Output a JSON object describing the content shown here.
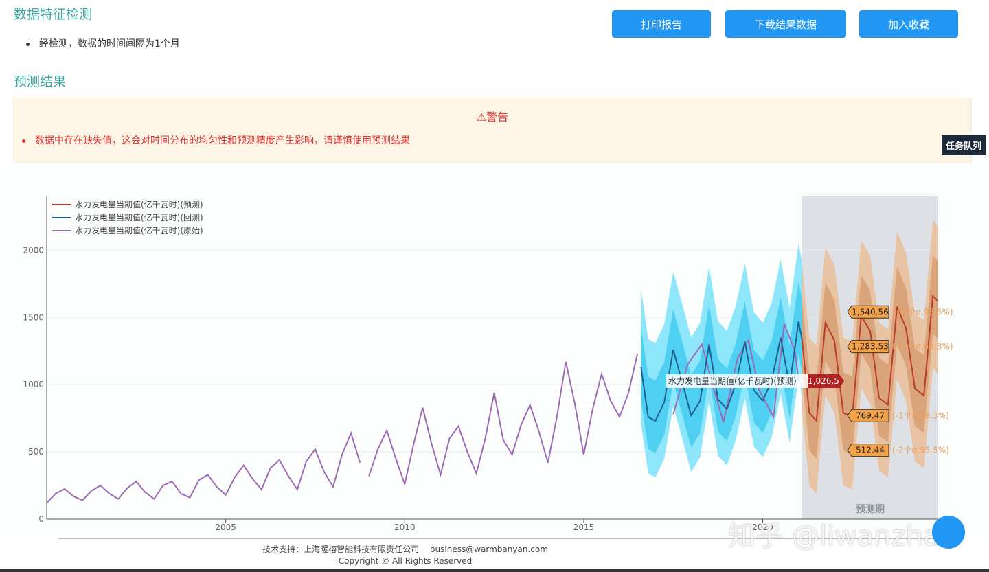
{
  "header": {
    "section1_title": "数据特征检测",
    "bullet": "经检测，数据的时间间隔为1个月",
    "section2_title": "预测结果"
  },
  "buttons": {
    "print": "打印报告",
    "download": "下载结果数据",
    "favorite": "加入收藏"
  },
  "warning": {
    "title": "⚠警告",
    "message": "数据中存在缺失值，这会对时间分布的均匀性和预测精度产生影响，请谨慎使用预测结果"
  },
  "side_tab": "任务队列",
  "footer": {
    "support": "技术支持：上海暖榕智能科技有限责任公司　 business@warmbanyan.com",
    "copyright": "Copyright ©  All Rights Reserved"
  },
  "watermark": "知乎 @liwanzhao",
  "colors": {
    "forecast": "#c0392b",
    "backtest": "#1f5f8b",
    "original": "#9b6bb5",
    "backtest_band_outer": "#8ee6fa",
    "backtest_band_inner": "#4fd0f3",
    "forecast_band_outer": "#e8c3a4",
    "forecast_band_inner": "#d9a47a",
    "forecast_period_bg": "#dde1e6"
  },
  "chart_data": {
    "type": "line",
    "title": "",
    "xlabel": "",
    "ylabel": "",
    "xlim": [
      2000.0,
      2024.9
    ],
    "ylim": [
      0,
      2400
    ],
    "x_ticks": [
      2005,
      2010,
      2015,
      2020
    ],
    "y_ticks": [
      0,
      500,
      1000,
      1500,
      2000
    ],
    "legend": [
      "水力发电量当期值(亿千瓦时)(预测)",
      "水力发电量当期值(亿千瓦时)(回测)",
      "水力发电量当期值(亿千瓦时)(原始)"
    ],
    "legend_position": "top-left",
    "forecast_region": {
      "start": 2021.1,
      "end": 2024.9,
      "label": "预测期"
    },
    "tooltip": {
      "series": "水力发电量当期值(亿千瓦时)(预测)",
      "value": "1,026.5"
    },
    "band_labels": [
      {
        "value": "1,540.56",
        "note": "(+2个σ,95.5%)"
      },
      {
        "value": "1,283.53",
        "note": "(+1个σ,68.3%)"
      },
      {
        "value": "769.47",
        "note": "(-1个σ,68.3%)"
      },
      {
        "value": "512.44",
        "note": "(-2个σ,95.5%)"
      }
    ],
    "series": [
      {
        "name": "水力发电量当期值(亿千瓦时)(原始)",
        "segments": [
          {
            "x": [
              2000.0,
              2000.25,
              2000.5,
              2000.75,
              2001.0,
              2001.25,
              2001.5,
              2001.75,
              2002.0,
              2002.25,
              2002.5,
              2002.75,
              2003.0,
              2003.25,
              2003.5,
              2003.75,
              2004.0,
              2004.25,
              2004.5,
              2004.75,
              2005.0,
              2005.25,
              2005.5,
              2005.75,
              2006.0,
              2006.25,
              2006.5,
              2006.75,
              2007.0,
              2007.25,
              2007.5,
              2007.75,
              2008.0,
              2008.25,
              2008.5,
              2008.75
            ],
            "y": [
              120,
              190,
              225,
              170,
              140,
              210,
              250,
              190,
              150,
              230,
              280,
              200,
              150,
              250,
              280,
              190,
              160,
              290,
              330,
              240,
              180,
              310,
              400,
              300,
              220,
              380,
              440,
              320,
              220,
              430,
              520,
              350,
              240,
              480,
              640,
              420
            ]
          },
          {
            "x": [
              2009.0,
              2009.25,
              2009.5,
              2009.75,
              2010.0,
              2010.25,
              2010.5,
              2010.75,
              2011.0,
              2011.25,
              2011.5,
              2011.75,
              2012.0,
              2012.25,
              2012.5,
              2012.75,
              2013.0,
              2013.25,
              2013.5,
              2013.75,
              2014.0,
              2014.25,
              2014.5,
              2014.75,
              2015.0,
              2015.25,
              2015.5,
              2015.75,
              2016.0,
              2016.25,
              2016.5
            ],
            "y": [
              320,
              520,
              660,
              450,
              260,
              560,
              830,
              560,
              330,
              600,
              690,
              500,
              340,
              600,
              940,
              590,
              480,
              700,
              850,
              650,
              420,
              760,
              1170,
              860,
              480,
              820,
              1080,
              880,
              760,
              940,
              1230
            ]
          },
          {
            "x": [
              2017.5,
              2017.9,
              2018.3,
              2018.6,
              2018.9,
              2019.3,
              2019.6,
              2019.9,
              2020.3,
              2020.6,
              2020.9,
              2021.0
            ],
            "y": [
              780,
              1150,
              1300,
              1000,
              720,
              1200,
              1330,
              960,
              760,
              1450,
              1250,
              1030
            ]
          }
        ]
      },
      {
        "name": "水力发电量当期值(亿千瓦时)(回测)",
        "x": [
          2016.6,
          2016.8,
          2017.0,
          2017.25,
          2017.5,
          2017.75,
          2018.0,
          2018.25,
          2018.5,
          2018.75,
          2019.0,
          2019.25,
          2019.5,
          2019.75,
          2020.0,
          2020.25,
          2020.5,
          2020.75,
          2021.0,
          2021.1
        ],
        "y": [
          1130,
          760,
          730,
          870,
          1260,
          1020,
          770,
          880,
          1300,
          890,
          820,
          1010,
          1320,
          960,
          880,
          1030,
          1350,
          990,
          1470,
          1330
        ]
      },
      {
        "name": "水力发电量当期值(亿千瓦时)(预测)",
        "x": [
          2021.1,
          2021.3,
          2021.5,
          2021.75,
          2022.0,
          2022.25,
          2022.5,
          2022.75,
          2023.0,
          2023.25,
          2023.5,
          2023.75,
          2024.0,
          2024.25,
          2024.5,
          2024.75,
          2024.9
        ],
        "y": [
          1330,
          790,
          730,
          1460,
          1330,
          790,
          760,
          1510,
          1400,
          900,
          850,
          1580,
          1420,
          970,
          920,
          1660,
          1620
        ]
      }
    ]
  }
}
